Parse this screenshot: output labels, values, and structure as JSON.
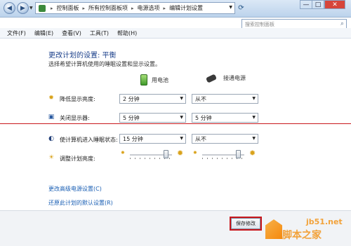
{
  "titlebar": {
    "breadcrumbs": [
      "控制面板",
      "所有控制面板项",
      "电源选项",
      "编辑计划设置"
    ],
    "search_placeholder": "搜索控制面板",
    "controls": [
      "—",
      "□",
      "✕"
    ]
  },
  "menu": [
    "文件(F)",
    "编辑(E)",
    "查看(V)",
    "工具(T)",
    "帮助(H)"
  ],
  "page": {
    "title": "更改计划的设置: 平衡",
    "subtitle": "选择希望计算机使用的睡眠设置和显示设置。",
    "col_battery": "用电池",
    "col_plugged": "接通电源"
  },
  "rows": [
    {
      "label": "降低显示亮度:",
      "battery": "2 分钟",
      "plugged": "从不"
    },
    {
      "label": "关闭显示器:",
      "battery": "5 分钟",
      "plugged": "5 分钟"
    },
    {
      "label": "使计算机进入睡眠状态:",
      "battery": "15 分钟",
      "plugged": "从不"
    }
  ],
  "brightness": {
    "label": "调整计划亮度:",
    "battery_level": 0.9,
    "plugged_level": 0.9
  },
  "links": {
    "advanced": "更改高级电源设置(C)",
    "restore": "还原此计划的默认设置(R)"
  },
  "buttons": {
    "save": "保存修改"
  },
  "watermark": {
    "line1": "jb51.net",
    "line2": "脚本之家"
  },
  "colors": {
    "accent_red": "#c8171c",
    "link_blue": "#1a5fb4",
    "watermark_orange": "#f2a23a"
  }
}
